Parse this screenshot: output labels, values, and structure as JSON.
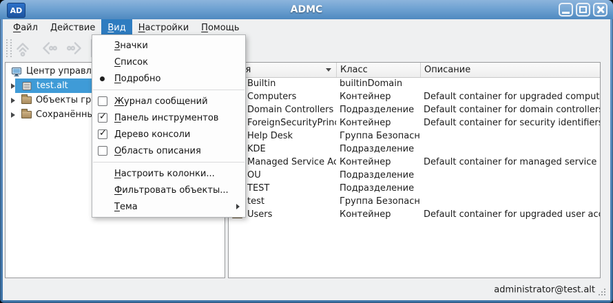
{
  "window": {
    "title": "ADMC",
    "app_icon_text": "AD"
  },
  "menubar": {
    "items": [
      {
        "key": "Ф",
        "rest": "айл"
      },
      {
        "key": "Д",
        "rest": "ействие"
      },
      {
        "key": "В",
        "rest": "ид",
        "active": true
      },
      {
        "key": "Н",
        "rest": "астройки"
      },
      {
        "key": "П",
        "rest": "омощь"
      }
    ]
  },
  "toolbar": {
    "icons": [
      "go-up",
      "go-back",
      "go-forward"
    ],
    "enabled": false
  },
  "view_menu": {
    "items": [
      {
        "key": "З",
        "rest": "начки",
        "type": "radio",
        "checked": false
      },
      {
        "key": "С",
        "rest": "писок",
        "type": "radio",
        "checked": false
      },
      {
        "key": "П",
        "rest": "одробно",
        "type": "radio",
        "checked": true
      },
      {
        "key": "Ж",
        "rest": "урнал сообщений",
        "type": "checkbox",
        "checked": false
      },
      {
        "key": "П",
        "rest": "анель инструментов",
        "type": "checkbox",
        "checked": true
      },
      {
        "key": "Д",
        "rest": "ерево консоли",
        "type": "checkbox",
        "checked": true
      },
      {
        "key": "О",
        "rest": "бласть описания",
        "type": "checkbox",
        "checked": false
      },
      {
        "key": "Н",
        "rest": "астроить колонки...",
        "type": "action"
      },
      {
        "key": "Ф",
        "rest": "ильтровать объекты...",
        "type": "action"
      },
      {
        "key": "Т",
        "rest": "ема",
        "type": "submenu"
      }
    ]
  },
  "sidebar": {
    "items": [
      {
        "label": "Центр управлен",
        "icon": "computer",
        "depth": 0,
        "selected": false
      },
      {
        "label": "test.alt",
        "icon": "domain",
        "depth": 1,
        "selected": true
      },
      {
        "label": "Объекты груп",
        "icon": "folder",
        "depth": 1,
        "selected": false
      },
      {
        "label": "Сохранённые",
        "icon": "folder",
        "depth": 1,
        "selected": false
      }
    ]
  },
  "table": {
    "columns": [
      {
        "label": "Имя",
        "sort": "desc"
      },
      {
        "label": "Класс",
        "sort": ""
      },
      {
        "label": "Описание",
        "sort": ""
      }
    ],
    "rows": [
      {
        "name": "Builtin",
        "class": "builtinDomain",
        "desc": ""
      },
      {
        "name": "Computers",
        "class": "Контейнер",
        "desc": "Default container for upgraded computer ac..."
      },
      {
        "name": "Domain Controllers",
        "class": "Подразделение",
        "desc": "Default container for domain controllers"
      },
      {
        "name": "ForeignSecurityPrinci...",
        "class": "Контейнер",
        "desc": "Default container for security identifiers (SID..."
      },
      {
        "name": "Help Desk",
        "class": "Группа Безопасн...",
        "desc": ""
      },
      {
        "name": "KDE",
        "class": "Подразделение",
        "desc": ""
      },
      {
        "name": "Managed Service Acc...",
        "class": "Контейнер",
        "desc": "Default container for managed service acco..."
      },
      {
        "name": "OU",
        "class": "Подразделение",
        "desc": ""
      },
      {
        "name": "TEST",
        "class": "Подразделение",
        "desc": ""
      },
      {
        "name": "test",
        "class": "Группа Безопасн...",
        "desc": ""
      },
      {
        "name": "Users",
        "class": "Контейнер",
        "desc": "Default container for upgraded user accounts"
      }
    ]
  },
  "statusbar": {
    "user": "administrator@test.alt"
  },
  "colors": {
    "titlebar_top": "#8cb4dc",
    "titlebar_bottom": "#4f89c0",
    "menu_highlight": "#2e7cc0",
    "tree_selection": "#3f9bd7",
    "content_bg": "#eff0f1",
    "panel_border": "#98999b",
    "folder": "#b3975f",
    "disabled_icon": "#c9ccd0"
  }
}
